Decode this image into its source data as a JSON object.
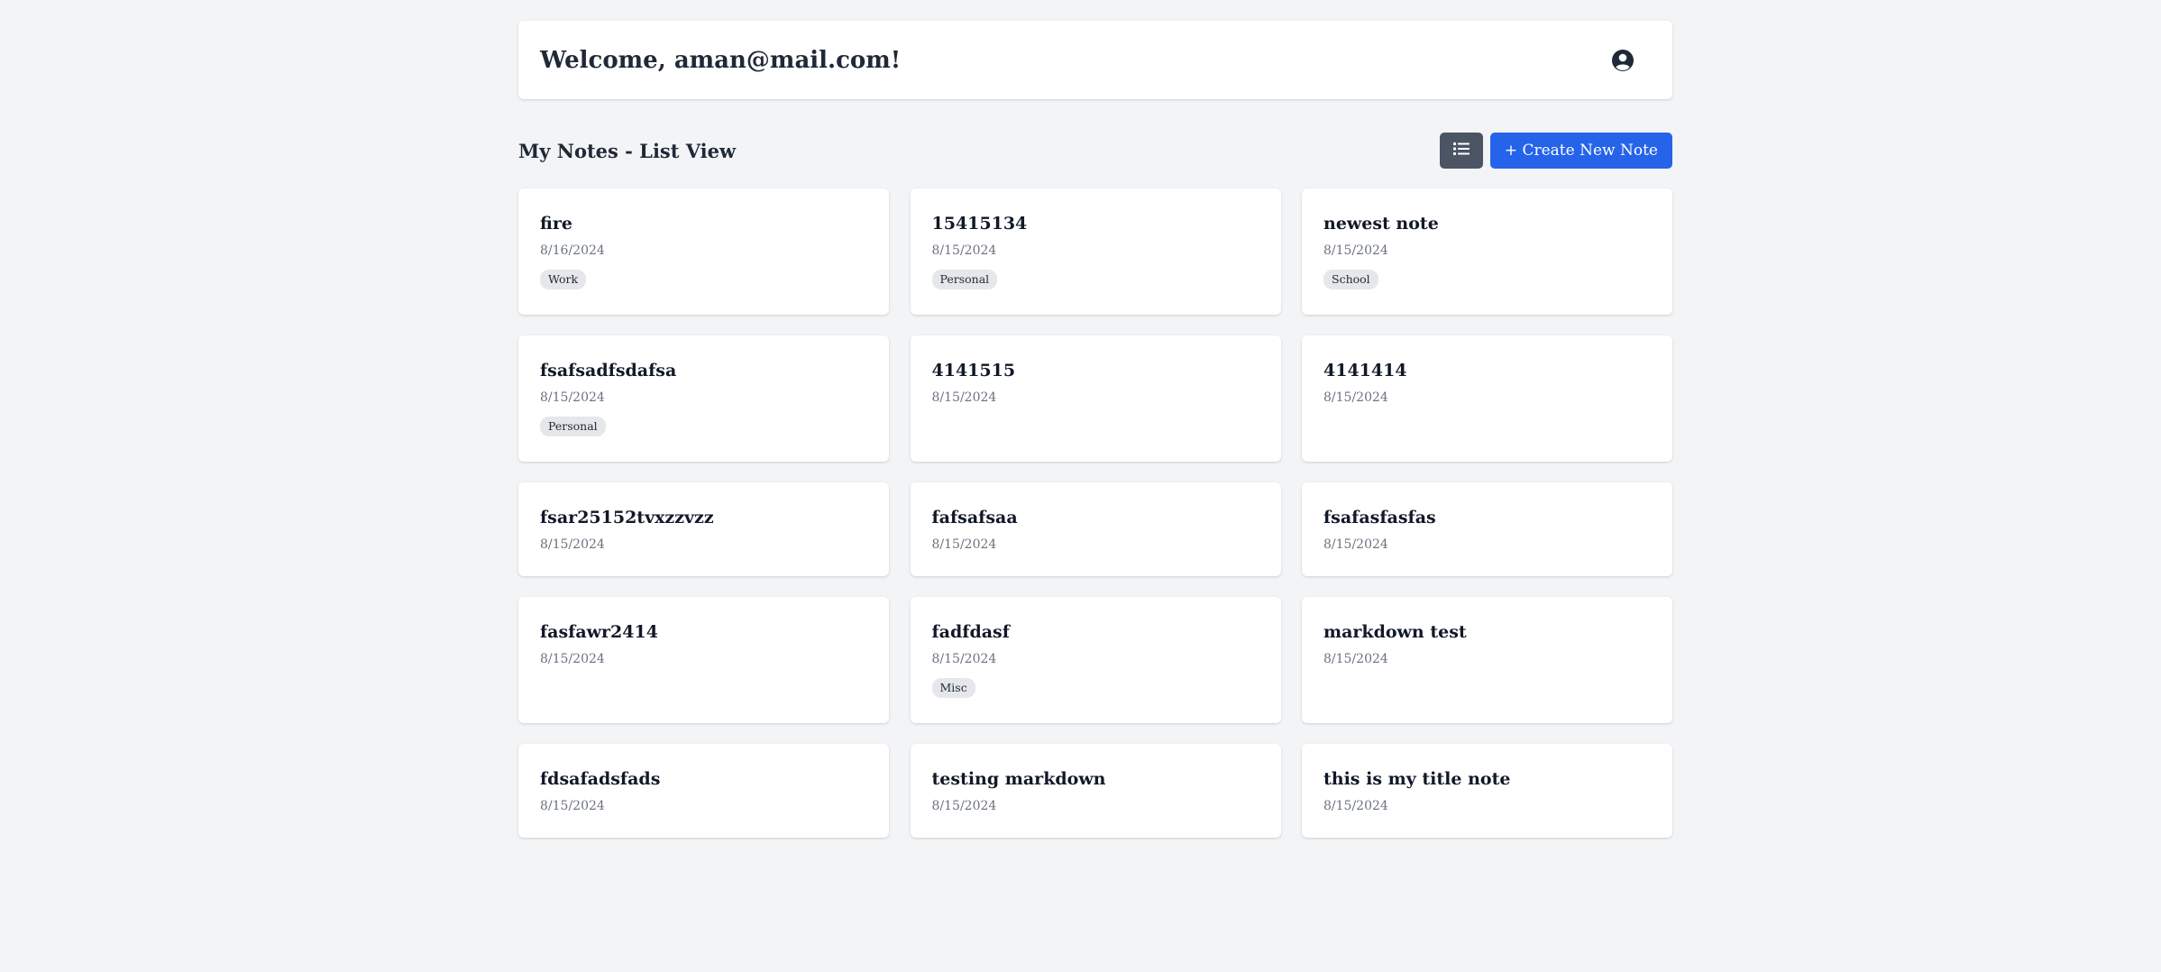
{
  "header": {
    "welcome_text": "Welcome, aman@mail.com!",
    "user_icon": "user-circle-icon"
  },
  "toolbar": {
    "title": "My Notes - List View",
    "view_toggle_icon": "list-icon",
    "create_label": "+ Create New Note"
  },
  "colors": {
    "background": "#f3f4f6",
    "primary": "#2563eb",
    "toggle": "#4b5563",
    "tag_bg": "#e5e7eb"
  },
  "notes": [
    {
      "title": "fire",
      "date": "8/16/2024",
      "tag": "Work"
    },
    {
      "title": "15415134",
      "date": "8/15/2024",
      "tag": "Personal"
    },
    {
      "title": "newest note",
      "date": "8/15/2024",
      "tag": "School"
    },
    {
      "title": "fsafsadfsdafsa",
      "date": "8/15/2024",
      "tag": "Personal"
    },
    {
      "title": "4141515",
      "date": "8/15/2024",
      "tag": ""
    },
    {
      "title": "4141414",
      "date": "8/15/2024",
      "tag": ""
    },
    {
      "title": "fsar25152tvxzzvzz",
      "date": "8/15/2024",
      "tag": ""
    },
    {
      "title": "fafsafsaa",
      "date": "8/15/2024",
      "tag": ""
    },
    {
      "title": "fsafasfasfas",
      "date": "8/15/2024",
      "tag": ""
    },
    {
      "title": "fasfawr2414",
      "date": "8/15/2024",
      "tag": ""
    },
    {
      "title": "fadfdasf",
      "date": "8/15/2024",
      "tag": "Misc"
    },
    {
      "title": "markdown test",
      "date": "8/15/2024",
      "tag": ""
    },
    {
      "title": "fdsafadsfads",
      "date": "8/15/2024",
      "tag": ""
    },
    {
      "title": "testing markdown",
      "date": "8/15/2024",
      "tag": ""
    },
    {
      "title": "this is my title note",
      "date": "8/15/2024",
      "tag": ""
    }
  ]
}
